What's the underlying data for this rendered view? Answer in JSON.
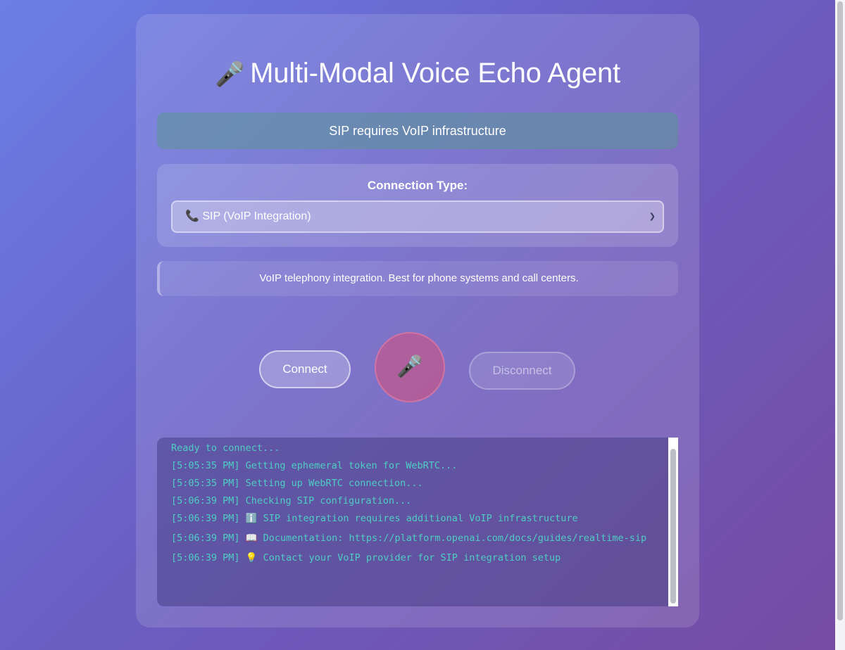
{
  "app": {
    "title_icon": "🎤",
    "title": "Multi-Modal Voice Echo Agent"
  },
  "status_banner": "SIP requires VoIP infrastructure",
  "connection": {
    "label": "Connection Type:",
    "selected_icon": "📞",
    "selected": "SIP (VoIP Integration)"
  },
  "description": "VoIP telephony integration. Best for phone systems and call centers.",
  "controls": {
    "connect_label": "Connect",
    "mic_icon": "🎤",
    "disconnect_label": "Disconnect"
  },
  "log": [
    "Ready to connect...",
    "[5:05:35 PM] Getting ephemeral token for WebRTC...",
    "[5:05:35 PM] Setting up WebRTC connection...",
    "[5:06:39 PM] Checking SIP configuration...",
    "[5:06:39 PM] ℹ️ SIP integration requires additional VoIP infrastructure",
    "[5:06:39 PM] 📖 Documentation: https://platform.openai.com/docs/guides/realtime-sip",
    "[5:06:39 PM] 💡 Contact your VoIP provider for SIP integration setup"
  ],
  "colors": {
    "background_start": "#6b7fe6",
    "background_end": "#764ba2",
    "log_text": "#4ecdc4",
    "mic_button": "#d75078"
  }
}
